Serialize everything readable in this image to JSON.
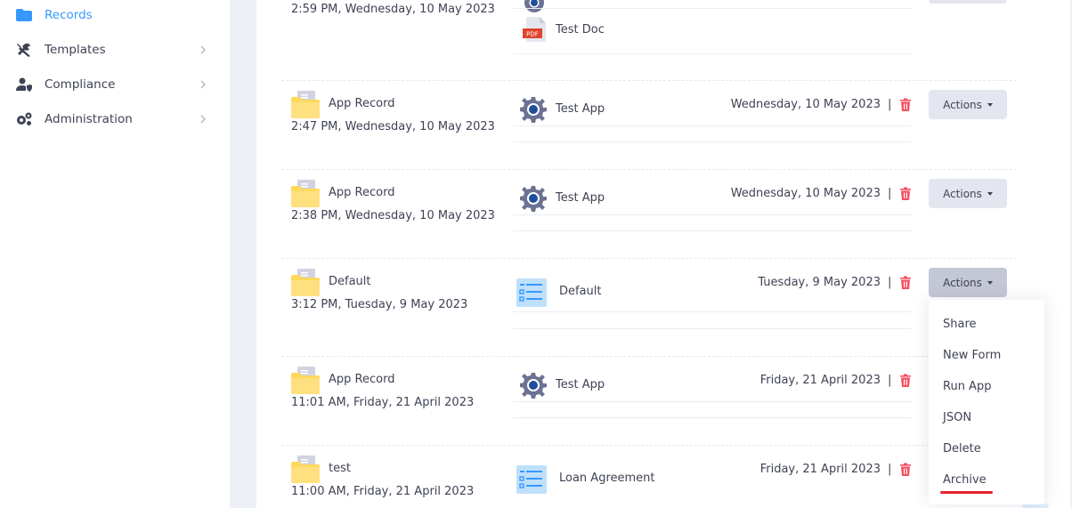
{
  "sidebar": {
    "items": [
      {
        "label": "Records",
        "icon": "folder-icon",
        "active": true
      },
      {
        "label": "Templates",
        "icon": "tools-icon"
      },
      {
        "label": "Compliance",
        "icon": "user-shield-icon"
      },
      {
        "label": "Administration",
        "icon": "cogs-icon"
      }
    ]
  },
  "records": [
    {
      "time": "2:59 PM, Wednesday, 10 May 2023",
      "item_label": "Test Doc",
      "item_icon": "pdf-icon",
      "pdf_badge": "PDF"
    },
    {
      "name": "App Record",
      "time": "2:47 PM, Wednesday, 10 May 2023",
      "item_label": "Test App",
      "item_icon": "gear-app-icon",
      "date": "Wednesday, 10 May 2023"
    },
    {
      "name": "App Record",
      "time": "2:38 PM, Wednesday, 10 May 2023",
      "item_label": "Test App",
      "item_icon": "gear-app-icon",
      "date": "Wednesday, 10 May 2023"
    },
    {
      "name": "Default",
      "time": "3:12 PM, Tuesday, 9 May 2023",
      "item_label": "Default",
      "item_icon": "form-icon",
      "date": "Tuesday, 9 May 2023"
    },
    {
      "name": "App Record",
      "time": "11:01 AM, Friday, 21 April 2023",
      "item_label": "Test App",
      "item_icon": "gear-app-icon",
      "date": "Friday, 21 April 2023"
    },
    {
      "name": "test",
      "time": "11:00 AM, Friday, 21 April 2023",
      "item_label": "Loan Agreement",
      "item_icon": "form-icon",
      "date": "Friday, 21 April 2023"
    }
  ],
  "separator": "|",
  "actions_label": "Actions",
  "actions_menu": [
    "Share",
    "New Form",
    "Run App",
    "JSON",
    "Delete",
    "Archive"
  ],
  "colors": {
    "accent": "#3699ff",
    "delete": "#f64e60",
    "annotation_underline": "#e8232b"
  }
}
